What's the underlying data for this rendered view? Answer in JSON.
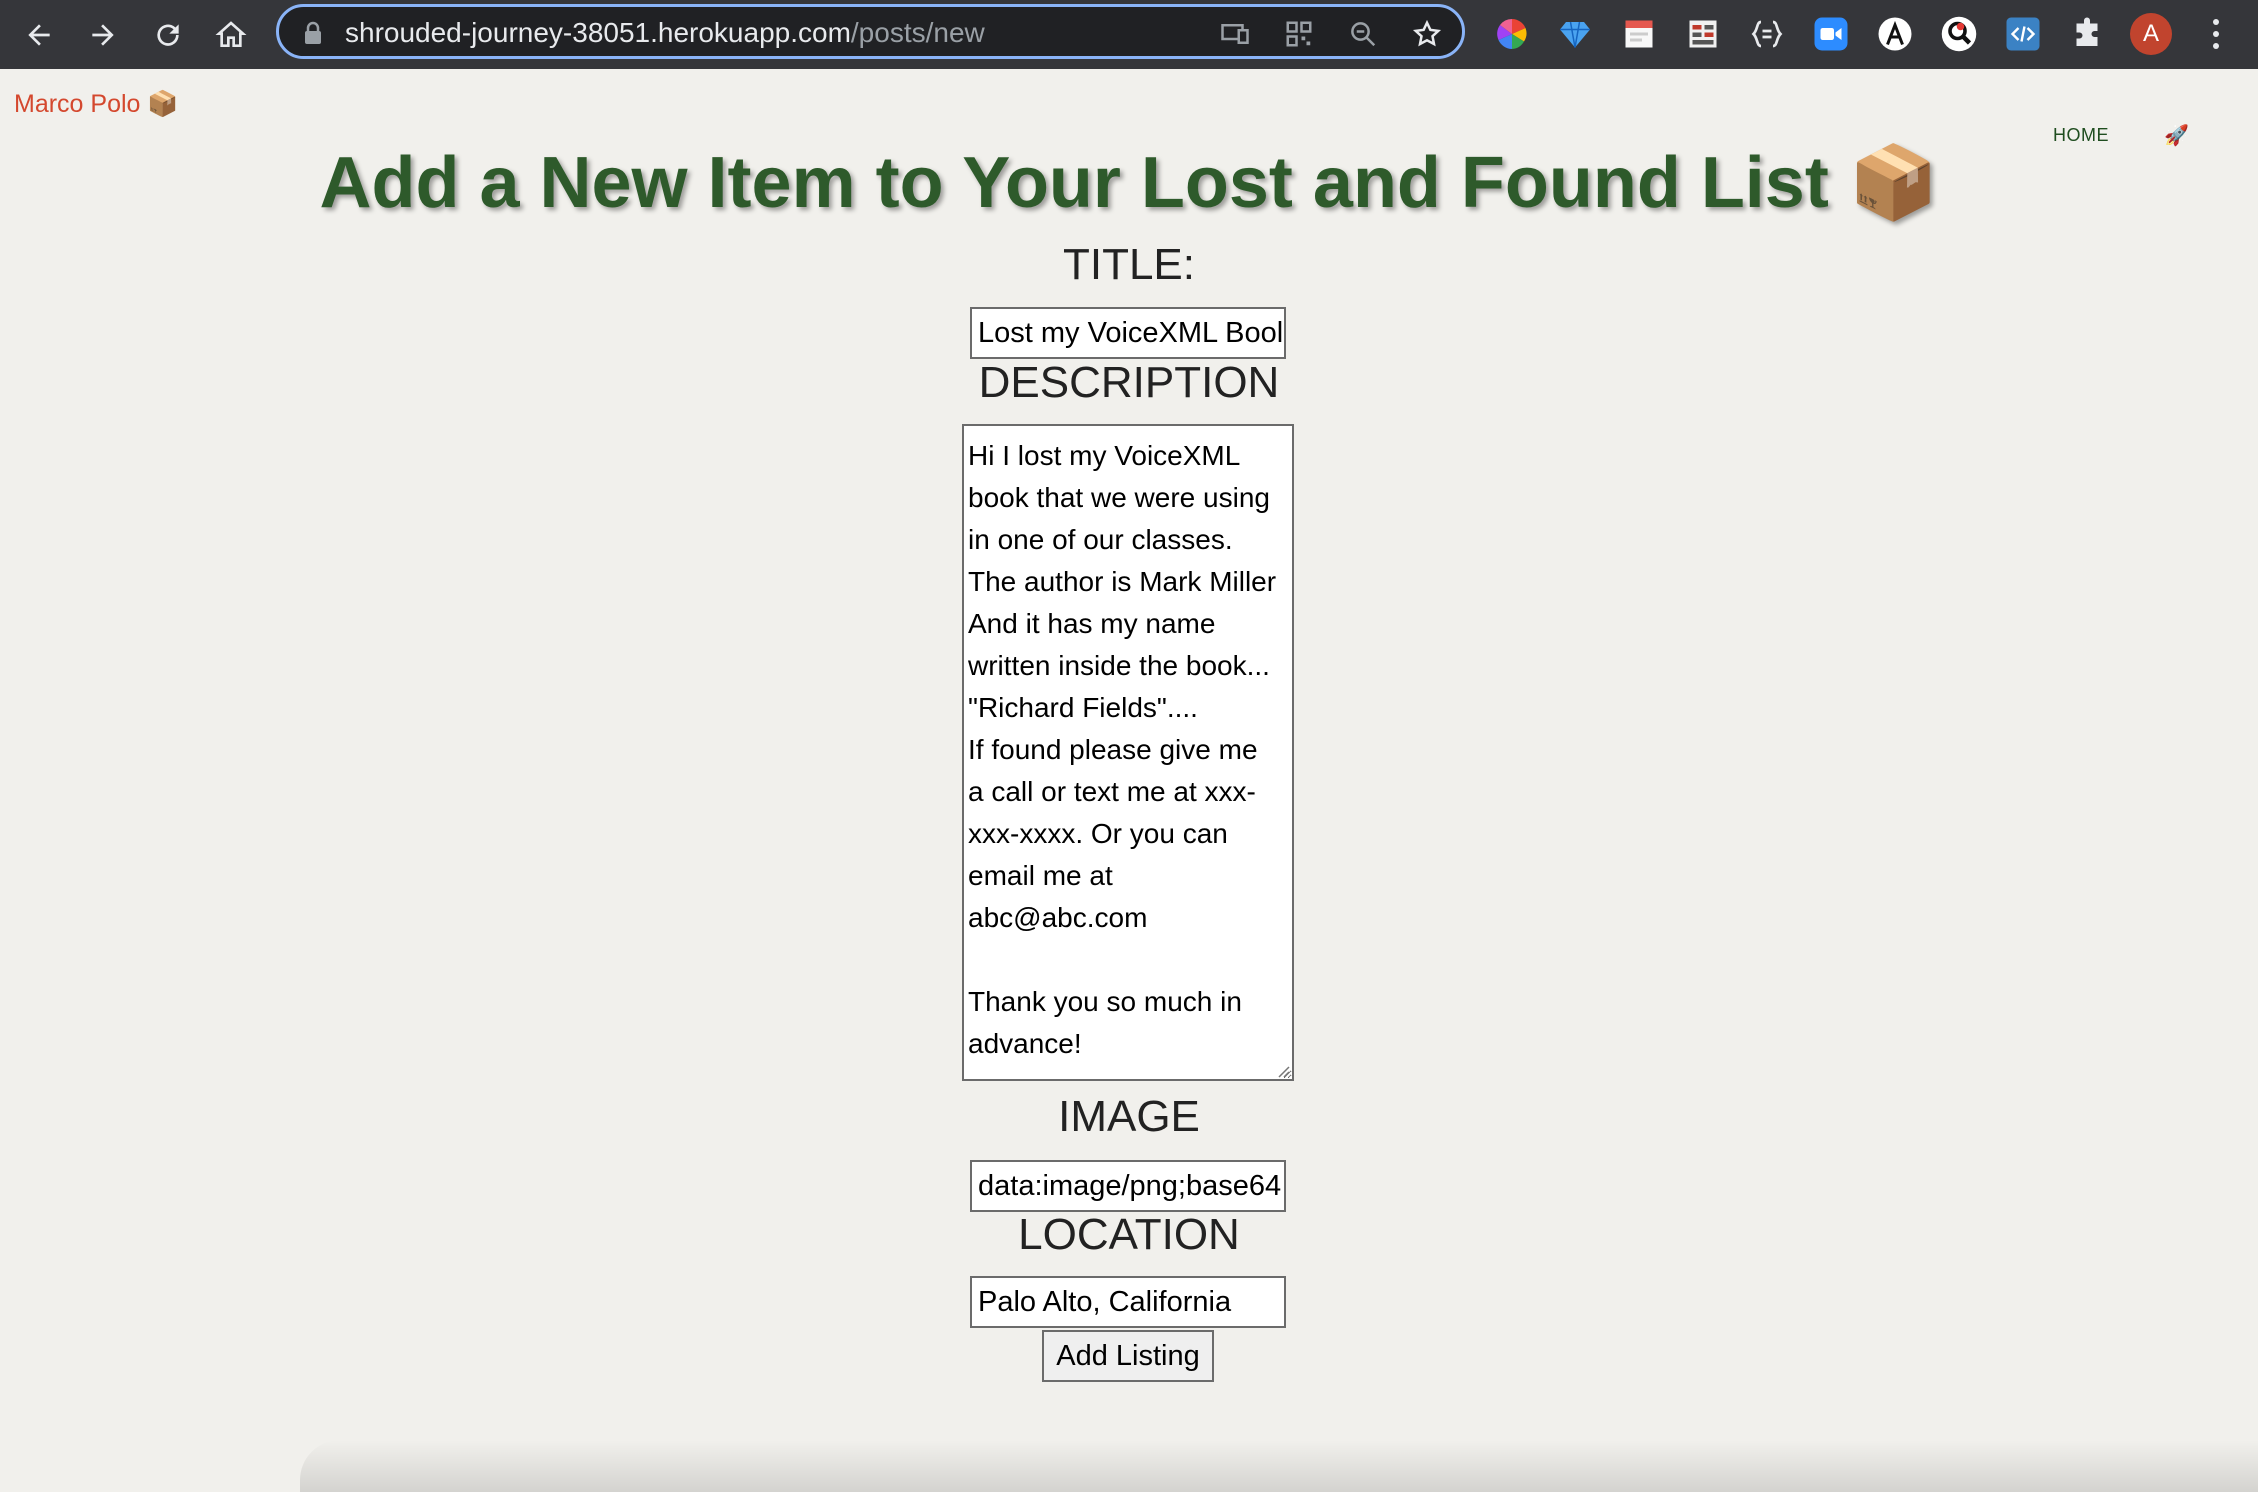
{
  "browser": {
    "url_host": "shrouded-journey-38051.herokuapp.com",
    "url_path": "/posts/new",
    "profile_initial": "A"
  },
  "nav": {
    "brand": "Marco Polo 📦",
    "home_label": "HOME",
    "rocket": "🚀"
  },
  "page": {
    "title": "Add a New Item to Your Lost and Found List 📦"
  },
  "form": {
    "title_label": "TITLE:",
    "title_value": "Lost my VoiceXML Bool",
    "description_label": "DESCRIPTION",
    "description_value": "Hi I lost my VoiceXML\nbook that we were using\nin one of our classes.\nThe author is Mark Miller\nAnd it has my name\nwritten inside the book...\n\"Richard Fields\"....\nIf found please give me\na call or text me at xxx-\nxxx-xxxx. Or you can\nemail me at\nabc@abc.com\n\nThank you so much in\nadvance!",
    "image_label": "IMAGE",
    "image_value": "data:image/png;base64",
    "location_label": "LOCATION",
    "location_value": "Palo Alto, California",
    "submit_label": "Add Listing"
  },
  "colors": {
    "title": "#2e5a2b",
    "brand": "#d4482e",
    "toolbar": "#35363a",
    "omnibox_focus": "#8ab4f8"
  }
}
